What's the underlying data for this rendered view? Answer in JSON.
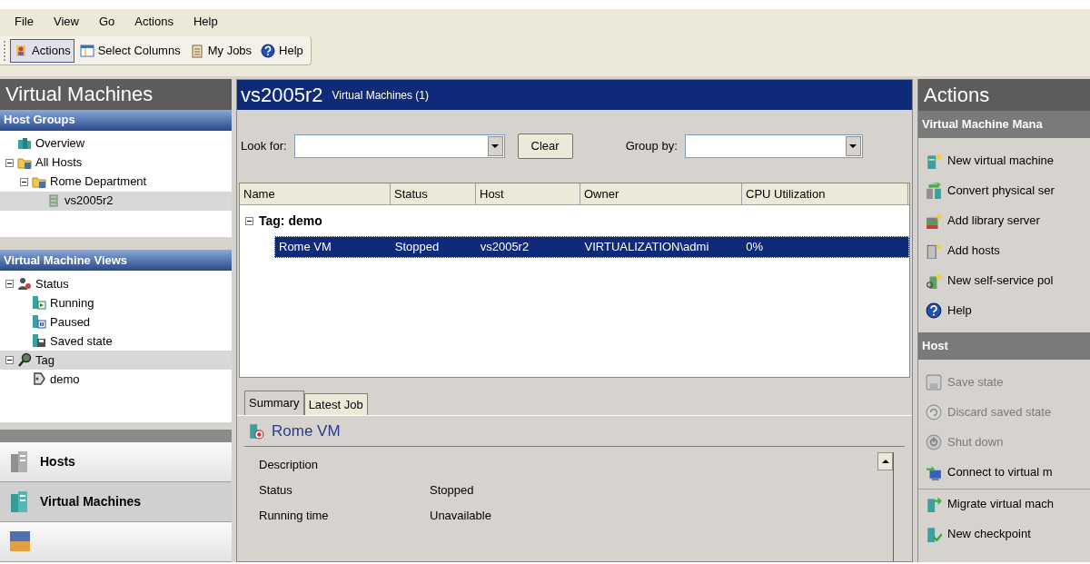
{
  "menu": [
    {
      "label": "File"
    },
    {
      "label": "View"
    },
    {
      "label": "Go"
    },
    {
      "label": "Actions"
    },
    {
      "label": "Help"
    }
  ],
  "toolbar": [
    {
      "label": "Actions",
      "kind": "actions",
      "pressed": true
    },
    {
      "label": "Select Columns",
      "kind": "columns",
      "pressed": false
    },
    {
      "label": "My Jobs",
      "kind": "jobs",
      "pressed": false
    },
    {
      "label": "Help",
      "kind": "help",
      "pressed": false
    }
  ],
  "left_pane": {
    "title": "Virtual Machines",
    "sections": [
      {
        "title": "Host Groups",
        "tree": [
          {
            "label": "Overview",
            "kind": "overview",
            "selected": false
          },
          {
            "label": "All Hosts",
            "kind": "folder",
            "selected": false,
            "expanded": true,
            "children": [
              {
                "label": "Rome Department",
                "kind": "folder",
                "selected": false,
                "expanded": true,
                "children": [
                  {
                    "label": "vs2005r2",
                    "kind": "server",
                    "selected": true
                  }
                ]
              }
            ]
          }
        ]
      },
      {
        "title": "Virtual Machine Views",
        "tree": [
          {
            "label": "Status",
            "kind": "status",
            "selected": false,
            "expanded": true,
            "children": [
              {
                "label": "Running",
                "kind": "running",
                "selected": false
              },
              {
                "label": "Paused",
                "kind": "paused",
                "selected": false
              },
              {
                "label": "Saved state",
                "kind": "saved",
                "selected": false
              }
            ]
          },
          {
            "label": "Tag",
            "kind": "tag",
            "selected": true,
            "expanded": true,
            "children": [
              {
                "label": "demo",
                "kind": "demo",
                "selected": false
              }
            ]
          }
        ]
      }
    ],
    "nav_buttons": [
      {
        "label": "Hosts",
        "kind": "hosts",
        "selected": false
      },
      {
        "label": "Virtual Machines",
        "kind": "vms",
        "selected": true
      },
      {
        "kind": "library",
        "selected": false
      }
    ]
  },
  "main": {
    "title": "vs2005r2",
    "subtitle": "Virtual Machines (1)",
    "look_for": {
      "label": "Look for:"
    },
    "clear_button": "Clear",
    "group_by": {
      "label": "Group by:"
    },
    "columns": [
      "Name",
      "Status",
      "Host",
      "Owner",
      "CPU Utilization"
    ],
    "groups": [
      {
        "label": "Tag: demo",
        "expanded": true,
        "rows": [
          {
            "cells": [
              "Rome VM",
              "Stopped",
              "vs2005r2",
              "VIRTUALIZATION\\admi",
              "0%"
            ],
            "selected": true
          }
        ]
      }
    ],
    "tabs": [
      {
        "label": "Summary",
        "selected": true
      },
      {
        "label": "Latest Job",
        "selected": false
      }
    ],
    "summary": {
      "title": "Rome VM",
      "properties": [
        {
          "label": "Description"
        },
        {
          "label": "Status",
          "value": "Stopped"
        },
        {
          "label": "Running time",
          "value": "Unavailable"
        }
      ]
    }
  },
  "actions_pane": {
    "title": "Actions",
    "sections": [
      {
        "title": "Virtual Machine Mana",
        "items": [
          {
            "label": "New virtual machine",
            "kind": "new-vm",
            "disabled": false,
            "separator_before": false
          },
          {
            "label": "Convert physical ser",
            "kind": "convert",
            "disabled": false,
            "separator_before": false
          },
          {
            "label": "Add library server",
            "kind": "library-add",
            "disabled": false,
            "separator_before": false
          },
          {
            "label": "Add hosts",
            "kind": "add-hosts",
            "disabled": false,
            "separator_before": false
          },
          {
            "label": "New self-service pol",
            "kind": "portal",
            "disabled": false,
            "separator_before": false
          },
          {
            "label": "Help",
            "kind": "help",
            "disabled": false,
            "separator_before": false
          }
        ]
      },
      {
        "title": "Host",
        "items": [
          {
            "label": "Save state",
            "kind": "save-state",
            "disabled": true,
            "separator_before": false
          },
          {
            "label": "Discard saved state",
            "kind": "discard",
            "disabled": true,
            "separator_before": false
          },
          {
            "label": "Shut down",
            "kind": "shutdown",
            "disabled": true,
            "separator_before": false
          },
          {
            "label": "Connect to virtual m",
            "kind": "connect",
            "disabled": false,
            "separator_before": false
          },
          {
            "label": "Migrate virtual mach",
            "kind": "migrate",
            "disabled": false,
            "separator_before": true
          },
          {
            "label": "New checkpoint",
            "kind": "checkpoint",
            "disabled": false,
            "separator_before": false
          }
        ]
      }
    ]
  }
}
